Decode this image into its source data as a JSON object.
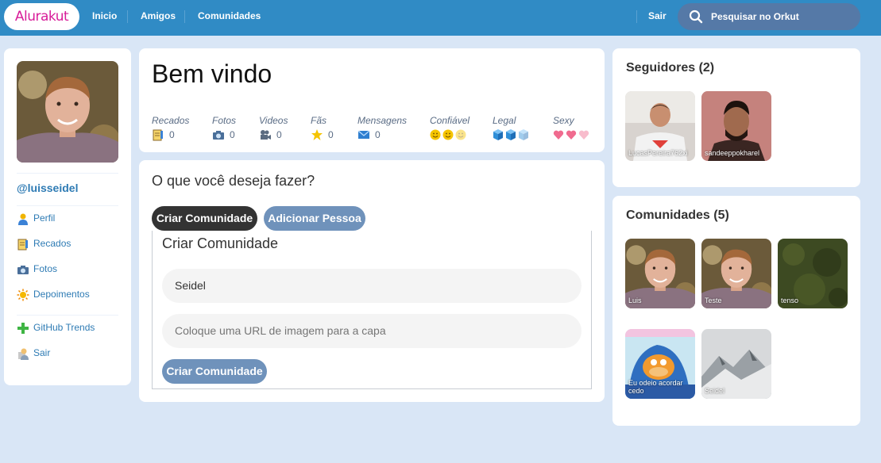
{
  "header": {
    "logo": "Alurakut",
    "nav": [
      "Inicio",
      "Amigos",
      "Comunidades"
    ],
    "logout": "Sair",
    "search_placeholder": "Pesquisar no Orkut"
  },
  "profile": {
    "username": "@luisseidel",
    "menu": [
      "Perfil",
      "Recados",
      "Fotos",
      "Depoimentos"
    ],
    "menu2": [
      "GitHub Trends",
      "Sair"
    ]
  },
  "welcome": {
    "title": "Bem vindo",
    "stats": [
      {
        "label": "Recados",
        "value": "0",
        "icon": "notebook-icon"
      },
      {
        "label": "Fotos",
        "value": "0",
        "icon": "camera-icon"
      },
      {
        "label": "Videos",
        "value": "0",
        "icon": "video-camera-icon"
      },
      {
        "label": "Fãs",
        "value": "0",
        "icon": "star-icon"
      },
      {
        "label": "Mensagens",
        "value": "0",
        "icon": "envelope-icon"
      },
      {
        "label": "Confiável",
        "icon": "smiley-icon",
        "level": 2
      },
      {
        "label": "Legal",
        "icon": "cube-icon",
        "level": 2
      },
      {
        "label": "Sexy",
        "icon": "heart-icon",
        "level": 2
      }
    ]
  },
  "create": {
    "question": "O que você deseja fazer?",
    "tab_create": "Criar Comunidade",
    "tab_add": "Adicionar Pessoa",
    "form_title": "Criar Comunidade",
    "name_value": "Seidel",
    "image_placeholder": "Coloque uma URL de imagem para a capa",
    "submit": "Criar Comunidade"
  },
  "followers": {
    "title": "Seguidores (2)",
    "items": [
      "LucasPereira762xi",
      "sandeeppokharel"
    ]
  },
  "communities": {
    "title": "Comunidades (5)",
    "items": [
      "Luis",
      "Teste",
      "tenso",
      "Eu odeio acordar cedo",
      "Seidel"
    ]
  },
  "colors": {
    "header": "#308bc5",
    "background": "#d9e6f6",
    "link": "#2e7bb4",
    "button_active": "#333333",
    "button": "#6f92bb",
    "logo": "#d81d99"
  }
}
